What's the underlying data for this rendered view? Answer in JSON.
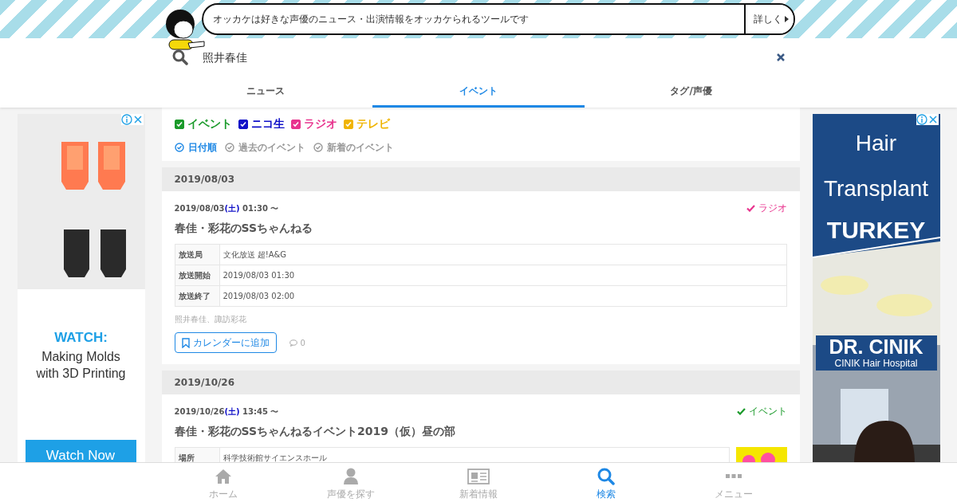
{
  "banner": {
    "text": "オッカケは好きな声優のニュース・出演情報をオッカケられるツールです",
    "more_label": "詳しく"
  },
  "search": {
    "value": "照井春佳"
  },
  "tabs": [
    {
      "label": "ニュース",
      "selected": false
    },
    {
      "label": "イベント",
      "selected": true
    },
    {
      "label": "タグ/声優",
      "selected": false
    }
  ],
  "filters": [
    {
      "label": "イベント",
      "checked": true,
      "color": "#1a9a2a"
    },
    {
      "label": "ニコ生",
      "checked": true,
      "color": "#1010c8"
    },
    {
      "label": "ラジオ",
      "checked": true,
      "color": "#e8348e"
    },
    {
      "label": "テレビ",
      "checked": true,
      "color": "#f0b400"
    }
  ],
  "sorts": [
    {
      "label": "日付順",
      "selected": true
    },
    {
      "label": "過去のイベント",
      "selected": false
    },
    {
      "label": "新着のイベント",
      "selected": false
    }
  ],
  "groups": [
    {
      "date": "2019/08/03",
      "events": [
        {
          "date": "2019/08/03",
          "weekday": "(土)",
          "time": " 01:30 〜",
          "category": {
            "label": "ラジオ",
            "color": "#e8348e"
          },
          "title": "春佳・彩花のSSちゃんねる",
          "details": [
            {
              "label": "放送局",
              "value": "文化放送 超!A&G"
            },
            {
              "label": "放送開始",
              "value": "2019/08/03 01:30"
            },
            {
              "label": "放送終了",
              "value": "2019/08/03 02:00"
            }
          ],
          "cast": "照井春佳、諏訪彩花",
          "calendar_label": "カレンダーに追加",
          "comments": "0"
        }
      ]
    },
    {
      "date": "2019/10/26",
      "events": [
        {
          "date": "2019/10/26",
          "weekday": "(土)",
          "time": " 13:45 〜",
          "category": {
            "label": "イベント",
            "color": "#1a9a2a"
          },
          "title": "春佳・彩花のSSちゃんねるイベント2019（仮）昼の部",
          "details": [
            {
              "label": "場所",
              "value": "科学技術館サイエンスホール"
            }
          ],
          "thumbnail": {
            "kind": "picture"
          }
        }
      ]
    }
  ],
  "ads": [
    {
      "kind": "video",
      "headline": "WATCH:",
      "lines": [
        "Making Molds",
        "with 3D Printing"
      ],
      "button": "Watch Now"
    },
    {
      "lines": [
        "Hair",
        "Transplant"
      ],
      "headline": "TURKEY",
      "brand": "DR. CINIK",
      "sub": "CINIK Hair Hospital"
    }
  ],
  "bottom_nav": [
    {
      "label": "ホーム",
      "selected": false
    },
    {
      "label": "声優を探す",
      "selected": false
    },
    {
      "label": "新着情報",
      "selected": false
    },
    {
      "label": "検索",
      "selected": true
    },
    {
      "label": "メニュー",
      "selected": false
    }
  ]
}
